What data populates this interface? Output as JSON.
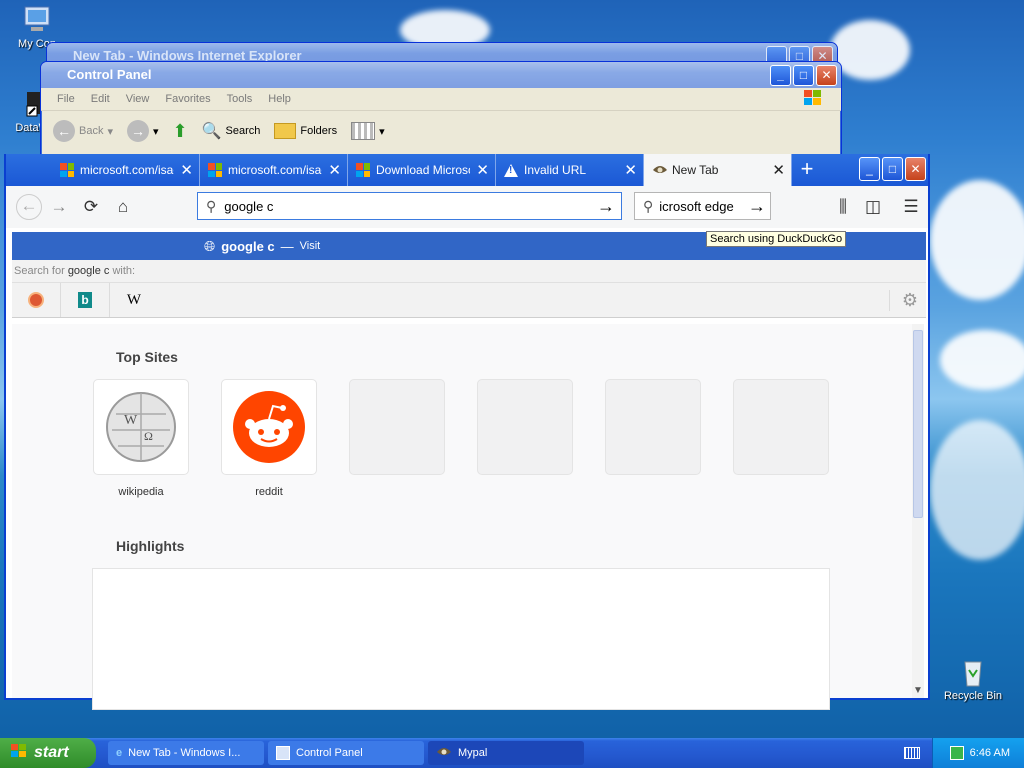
{
  "desktop": {
    "icons": [
      {
        "label": "My Con"
      },
      {
        "label": "DataWa"
      },
      {
        "label": "Recycle Bin"
      }
    ]
  },
  "ie_window": {
    "title": "New Tab - Windows Internet Explorer"
  },
  "control_panel": {
    "title": "Control Panel",
    "menu": [
      "File",
      "Edit",
      "View",
      "Favorites",
      "Tools",
      "Help"
    ],
    "toolbar": {
      "back": "Back",
      "search": "Search",
      "folders": "Folders"
    }
  },
  "browser": {
    "tabs": [
      {
        "label": "microsoft.com/isac",
        "icon": "microsoft-logo-icon"
      },
      {
        "label": "microsoft.com/isac",
        "icon": "microsoft-logo-icon"
      },
      {
        "label": "Download Microso",
        "icon": "microsoft-logo-icon"
      },
      {
        "label": "Invalid URL",
        "icon": "warning-icon"
      },
      {
        "label": "New Tab",
        "icon": "mypal-icon",
        "active": true
      }
    ],
    "url_value": "google c",
    "search_value": "icrosoft edge",
    "tooltip": "Search using DuckDuckGo",
    "suggestion": {
      "text": "google c",
      "dash": "—",
      "visit": "Visit"
    },
    "search_with": {
      "prefix": "Search for ",
      "query": "google c",
      "suffix": " with:"
    },
    "engines": [
      "duckduckgo-icon",
      "bing-icon",
      "W"
    ],
    "newtab": {
      "top_sites_title": "Top Sites",
      "sites": [
        {
          "label": "wikipedia"
        },
        {
          "label": "reddit"
        },
        {
          "label": ""
        },
        {
          "label": ""
        },
        {
          "label": ""
        },
        {
          "label": ""
        }
      ],
      "highlights_title": "Highlights"
    }
  },
  "taskbar": {
    "start": "start",
    "tasks": [
      {
        "label": "New Tab - Windows I..."
      },
      {
        "label": "Control Panel"
      },
      {
        "label": "Mypal"
      }
    ],
    "clock": "6:46 AM"
  }
}
